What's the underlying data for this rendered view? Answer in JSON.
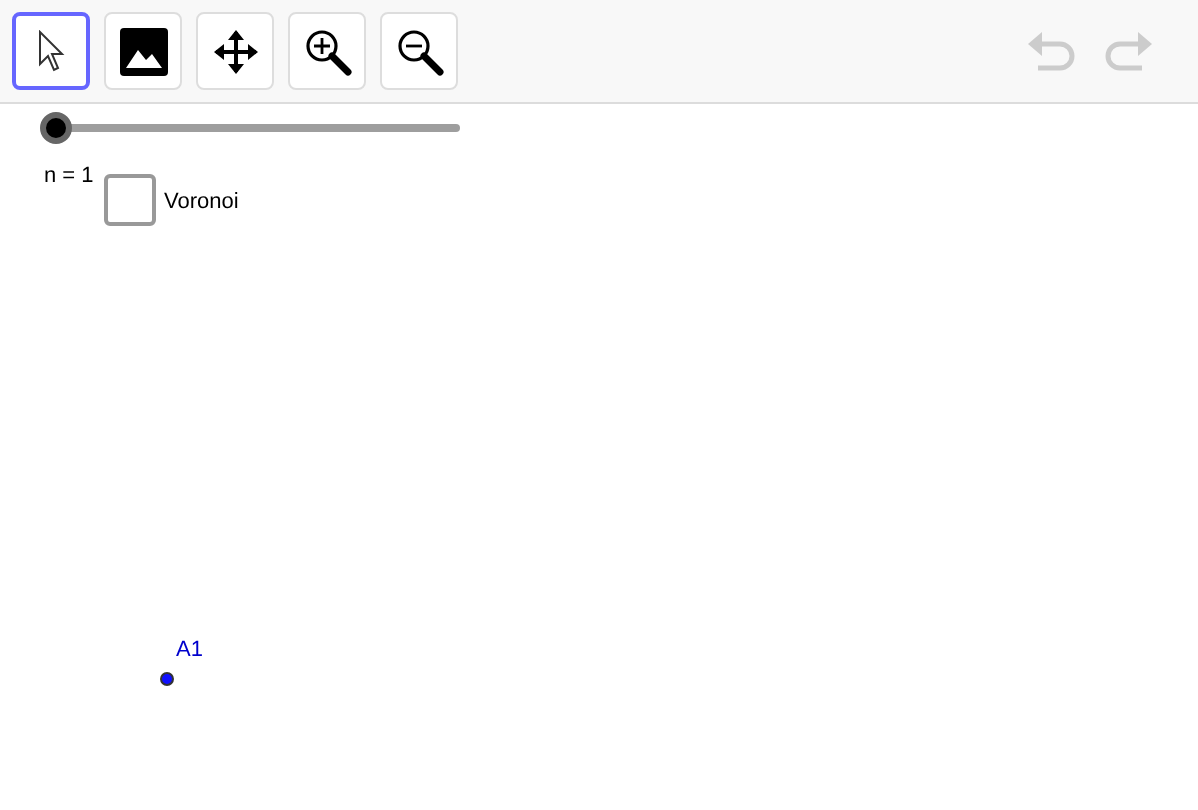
{
  "toolbar": {
    "tools": [
      {
        "kind": "pointer",
        "selected": true
      },
      {
        "kind": "image",
        "selected": false
      },
      {
        "kind": "move",
        "selected": false
      },
      {
        "kind": "zoom-in",
        "selected": false
      },
      {
        "kind": "zoom-out",
        "selected": false
      }
    ],
    "undo": {
      "disabled": true
    },
    "redo": {
      "disabled": true
    }
  },
  "canvas": {
    "slider": {
      "level": 0,
      "label": "n = 1"
    },
    "checkbox": {
      "label": "Voronoi",
      "checked": false
    },
    "point": {
      "label": "A1"
    }
  }
}
